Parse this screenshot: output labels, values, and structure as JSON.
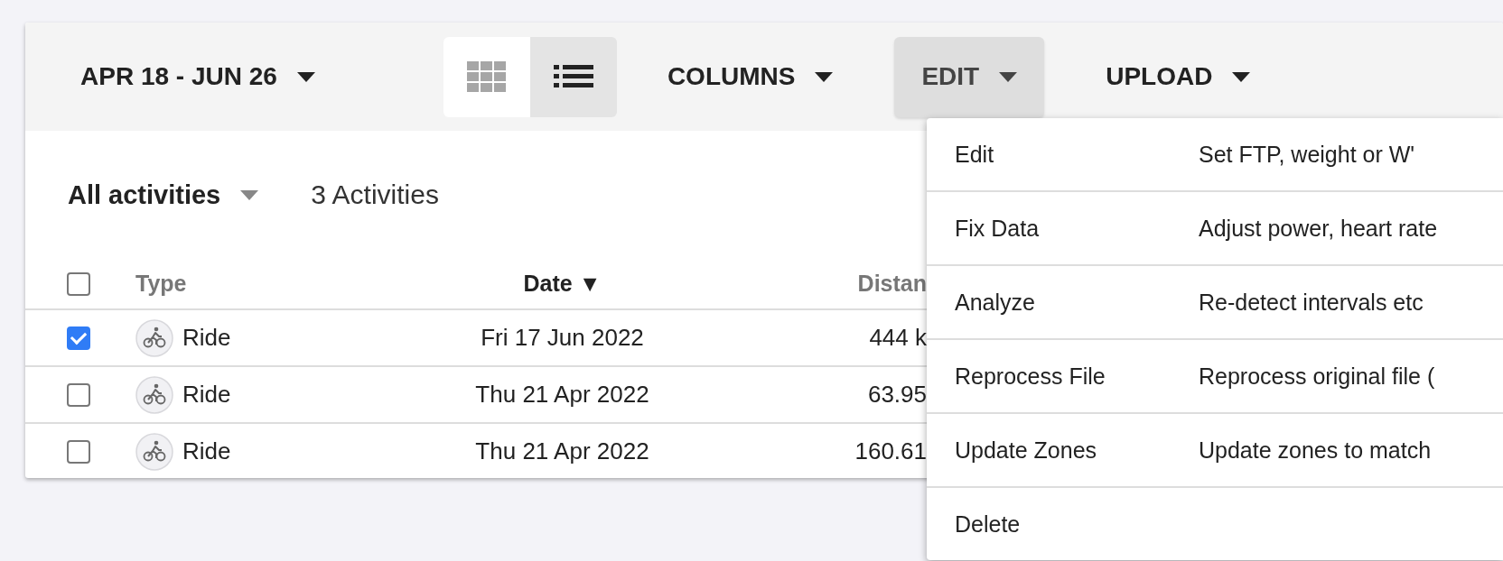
{
  "toolbar": {
    "date_range": "APR 18 - JUN 26",
    "view_toggle": [
      {
        "kind": "grid",
        "selected": false
      },
      {
        "kind": "list",
        "selected": true
      }
    ],
    "menus": [
      {
        "label": "COLUMNS",
        "open": false
      },
      {
        "label": "EDIT",
        "open": true
      },
      {
        "label": "UPLOAD",
        "open": false
      }
    ]
  },
  "filter": {
    "label": "All activities",
    "count": "3 Activities"
  },
  "table": {
    "header_checked": false,
    "columns": [
      {
        "label": "Type",
        "sorted": false
      },
      {
        "label": "Date",
        "sorted": true,
        "sort_icon": "▼"
      },
      {
        "label": "Distan",
        "sorted": false
      }
    ],
    "rows": [
      {
        "selected": true,
        "type": "Ride",
        "date": "Fri 17 Jun 2022",
        "distance": "444 k"
      },
      {
        "selected": false,
        "type": "Ride",
        "date": "Thu 21 Apr 2022",
        "distance": "63.95"
      },
      {
        "selected": false,
        "type": "Ride",
        "date": "Thu 21 Apr 2022",
        "distance": "160.61"
      }
    ]
  },
  "edit_menu": {
    "items": [
      {
        "label": "Edit",
        "description": "Set FTP, weight or W'"
      },
      {
        "label": "Fix Data",
        "description": "Adjust power, heart rate"
      },
      {
        "label": "Analyze",
        "description": "Re-detect intervals etc"
      },
      {
        "label": "Reprocess File",
        "description": "Reprocess original file ("
      },
      {
        "label": "Update Zones",
        "description": "Update zones to match"
      },
      {
        "label": "Delete"
      }
    ]
  }
}
